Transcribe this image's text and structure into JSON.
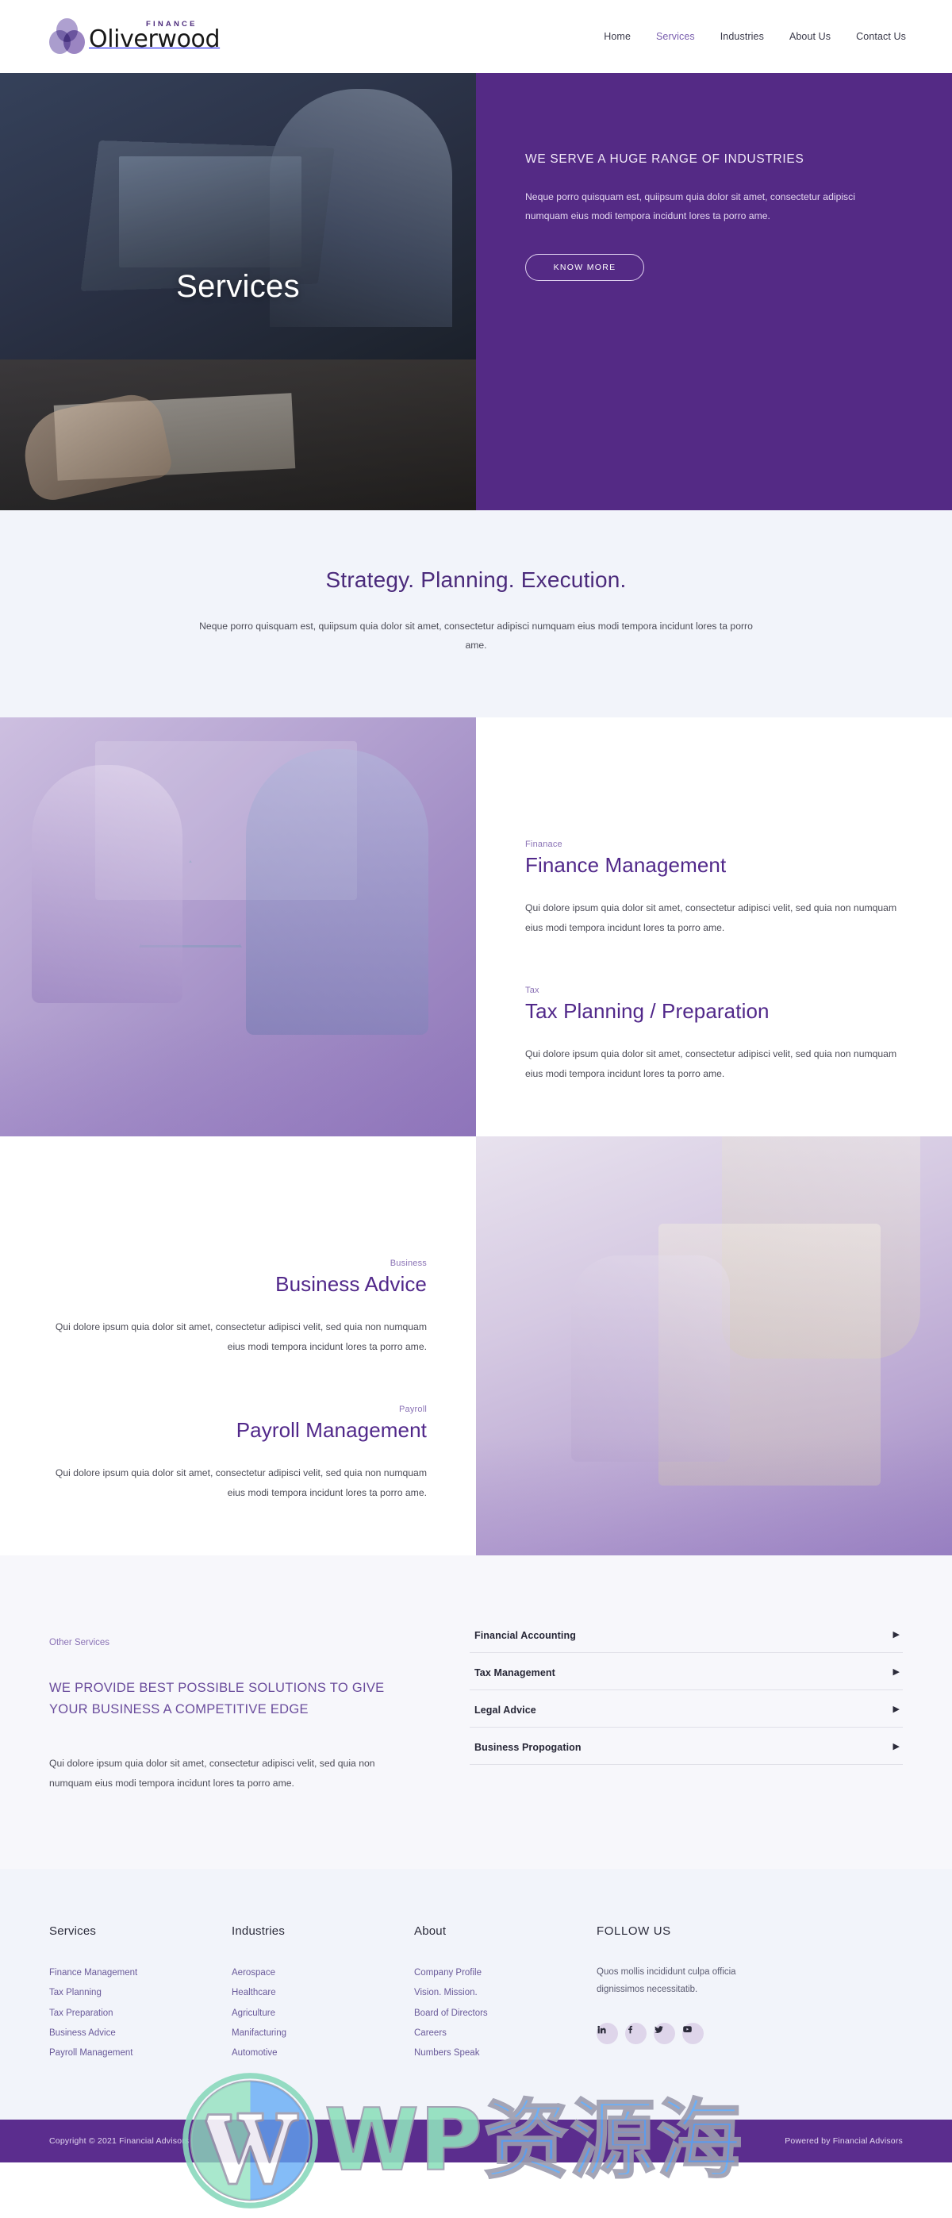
{
  "brand": {
    "finance_label": "FINANCE",
    "name": "Oliverwood"
  },
  "nav": {
    "items": [
      {
        "label": "Home",
        "active": false
      },
      {
        "label": "Services",
        "active": true
      },
      {
        "label": "Industries",
        "active": false
      },
      {
        "label": "About Us",
        "active": false
      },
      {
        "label": "Contact Us",
        "active": false
      }
    ]
  },
  "hero": {
    "title": "Services",
    "kicker": "WE SERVE A HUGE RANGE OF INDUSTRIES",
    "copy": "Neque porro quisquam est, quiipsum quia dolor sit amet, consectetur adipisci numquam eius modi tempora incidunt lores ta porro ame.",
    "button": "KNOW MORE",
    "panel_color": "#542A85"
  },
  "strategy": {
    "heading": "Strategy. Planning. Execution.",
    "copy": "Neque porro quisquam est, quiipsum quia dolor sit amet, consectetur adipisci numquam eius modi tempora incidunt lores ta porro ame."
  },
  "services": [
    {
      "eyebrow": "Finanace",
      "title": "Finance Management",
      "copy": "Qui dolore ipsum quia dolor sit amet, consectetur adipisci velit, sed quia non numquam eius modi tempora incidunt lores ta porro ame."
    },
    {
      "eyebrow": "Tax",
      "title": "Tax Planning / Preparation",
      "copy": "Qui dolore ipsum quia dolor sit amet, consectetur adipisci velit, sed quia non numquam eius modi tempora incidunt lores ta porro ame."
    },
    {
      "eyebrow": "Business",
      "title": "Business Advice",
      "copy": "Qui dolore ipsum quia dolor sit amet, consectetur adipisci velit, sed quia non numquam eius modi tempora incidunt lores ta porro ame."
    },
    {
      "eyebrow": "Payroll",
      "title": "Payroll Management",
      "copy": "Qui dolore ipsum quia dolor sit amet, consectetur adipisci velit, sed quia non numquam eius modi tempora incidunt lores ta porro ame."
    }
  ],
  "other_services": {
    "eyebrow": "Other Services",
    "heading": "WE PROVIDE BEST POSSIBLE SOLUTIONS TO GIVE YOUR BUSINESS A COMPETITIVE EDGE",
    "copy": "Qui dolore ipsum quia dolor sit amet, consectetur adipisci velit, sed quia non numquam eius modi tempora incidunt lores ta porro ame.",
    "accordion": [
      {
        "label": "Financial Accounting",
        "chevron": "▶"
      },
      {
        "label": "Tax Management",
        "chevron": "▶"
      },
      {
        "label": "Legal Advice",
        "chevron": "▶"
      },
      {
        "label": "Business Propogation",
        "chevron": "▶"
      }
    ]
  },
  "footer": {
    "columns": [
      {
        "title": "Services",
        "links": [
          "Finance Management",
          "Tax Planning",
          "Tax Preparation",
          "Business Advice",
          "Payroll Management"
        ]
      },
      {
        "title": "Industries",
        "links": [
          "Aerospace",
          "Healthcare",
          "Agriculture",
          "Manifacturing",
          "Automotive"
        ]
      },
      {
        "title": "About",
        "links": [
          "Company Profile",
          "Vision. Mission.",
          "Board of Directors",
          "Careers",
          "Numbers Speak"
        ]
      }
    ],
    "follow": {
      "title": "FOLLOW US",
      "copy": "Quos mollis incididunt culpa officia dignissimos necessitatib.",
      "socials": [
        "linkedin-icon",
        "facebook-icon",
        "twitter-icon",
        "youtube-icon"
      ]
    }
  },
  "bottom": {
    "copyright": "Copyright © 2021 Financial Advisors",
    "powered": "Powered by Financial Advisors",
    "bar_color": "#5b2d8e"
  },
  "watermark": {
    "wp": "WP",
    "cn": "资源海"
  }
}
